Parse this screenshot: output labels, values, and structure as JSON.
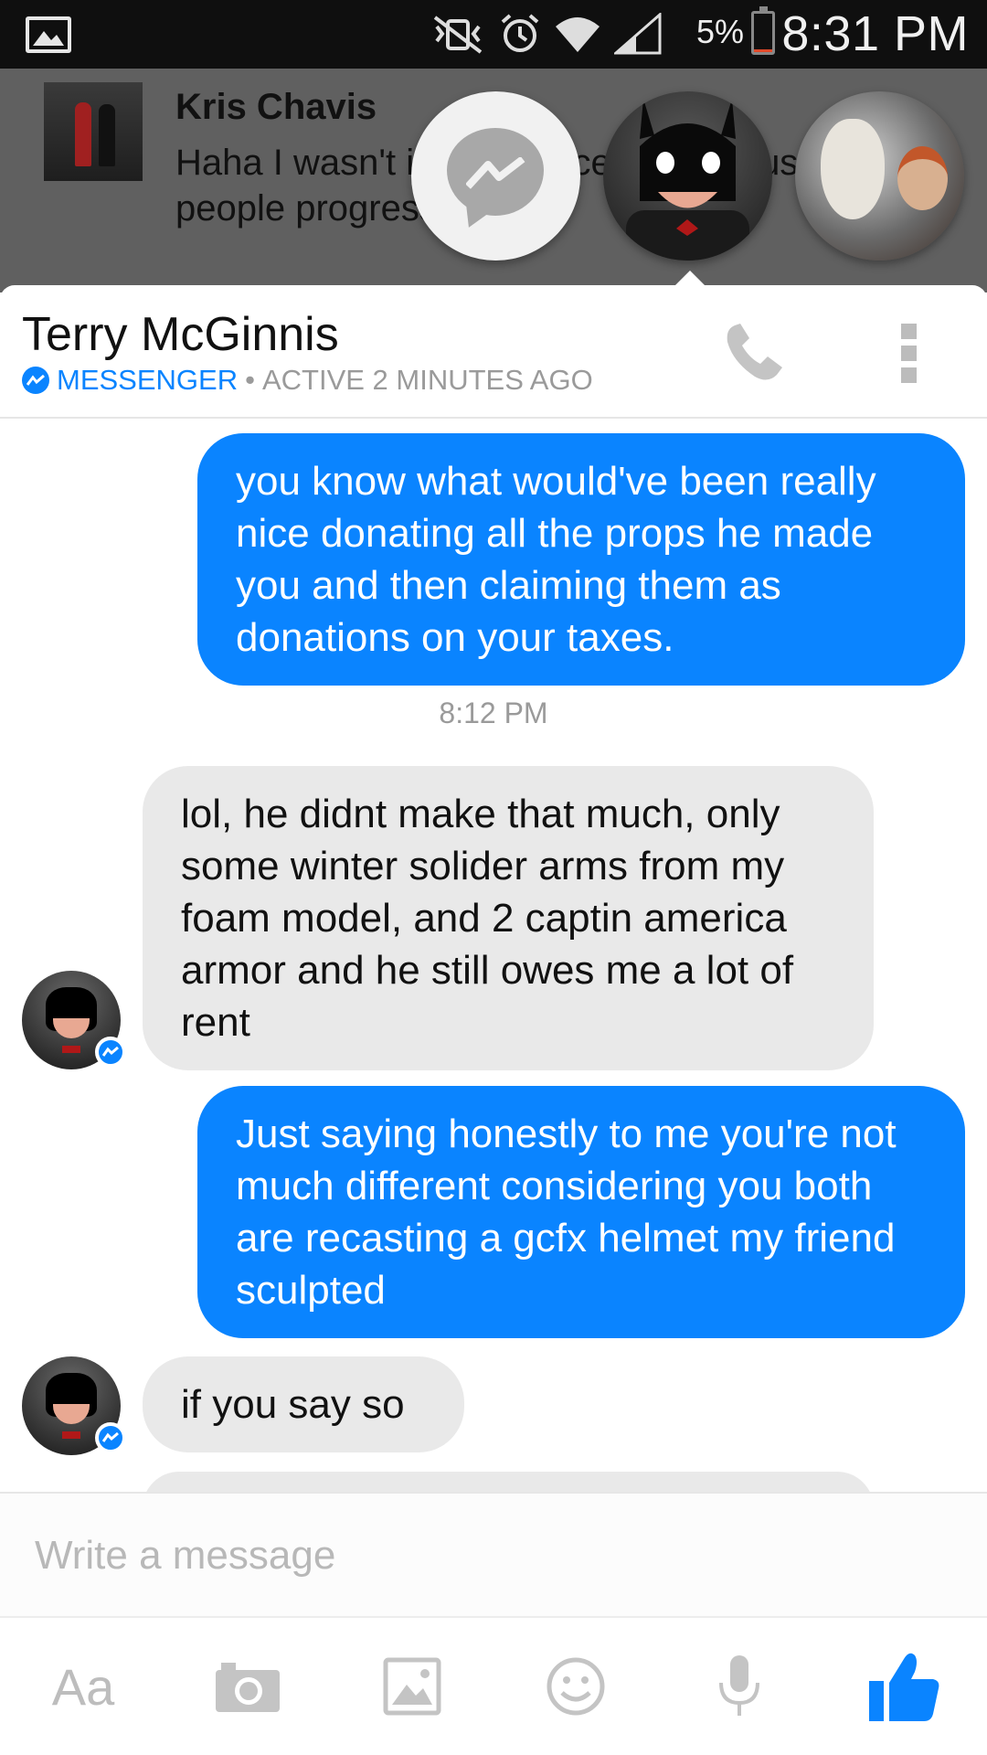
{
  "status_bar": {
    "battery_pct": "5%",
    "time": "8:31 PM"
  },
  "notification": {
    "sender": "Kris Chavis",
    "preview": "Haha I wasn't it hy all Facebook s e us people progress it"
  },
  "chat": {
    "title": "Terry McGinnis",
    "app_label": "MESSENGER",
    "separator": "•",
    "activity": "ACTIVE 2 MINUTES AGO"
  },
  "messages": [
    {
      "direction": "outgoing",
      "text": "you know what would've been really nice donating all the props he made you and then claiming them as donations on your taxes."
    },
    {
      "type": "timestamp",
      "text": "8:12 PM"
    },
    {
      "direction": "incoming",
      "text": "lol, he didnt make that much, only some winter solider arms from my foam model, and 2 captin america armor and he still owes me a lot of rent"
    },
    {
      "direction": "outgoing",
      "text": "Just saying honestly to me you're not much different considering you both are recasting a gcfx helmet my friend sculpted"
    },
    {
      "direction": "incoming",
      "text": "if you say so"
    }
  ],
  "composer": {
    "placeholder": "Write a message"
  },
  "toolbar": {
    "text_label": "Aa",
    "like_color": "#0a84ff"
  },
  "colors": {
    "accent": "#0a84ff",
    "incoming_bubble": "#e9e9e9",
    "muted": "#9a9a9a"
  }
}
